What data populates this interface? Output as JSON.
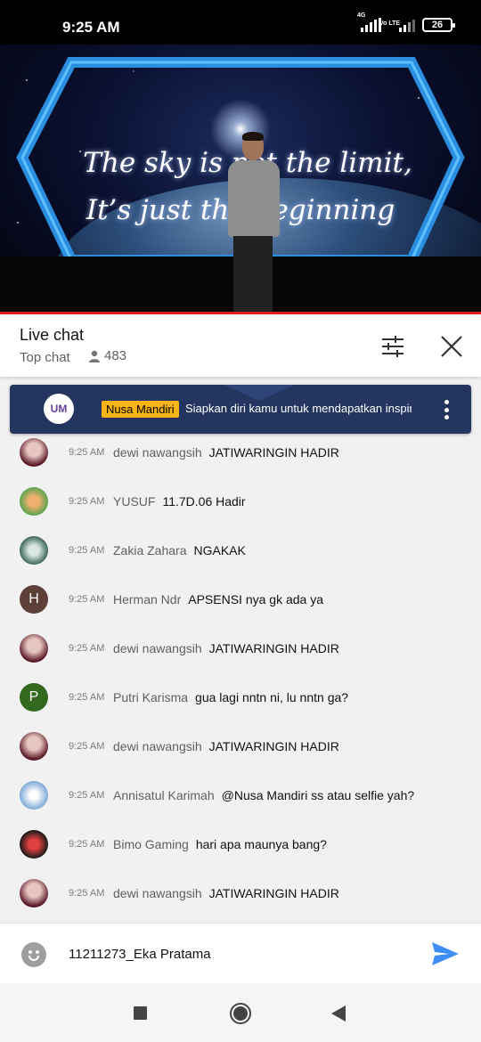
{
  "status_bar": {
    "time": "9:25 AM",
    "net_1": "4G",
    "net_2": "Vo LTE",
    "battery": "26"
  },
  "video": {
    "line1": "The sky is not the limit,",
    "line2": "It’s just the beginning"
  },
  "chat_header": {
    "title": "Live chat",
    "mode": "Top chat",
    "viewers": "483"
  },
  "pinned": {
    "author": "Nusa Mandiri",
    "text": "Siapkan diri kamu untuk mendapatkan inspirasi",
    "avatar_text": "UM"
  },
  "messages": [
    {
      "time": "9:25 AM",
      "author": "dewi nawangsih",
      "text": "JATIWARINGIN HADIR",
      "avatar": "photo"
    },
    {
      "time": "9:25 AM",
      "author": "YUSUF",
      "text": "11.7D.06 Hadir",
      "avatar": "photo"
    },
    {
      "time": "9:25 AM",
      "author": "Zakia Zahara",
      "text": "NGAKAK",
      "avatar": "photo"
    },
    {
      "time": "9:25 AM",
      "author": "Herman Ndr",
      "text": "APSENSI nya gk ada ya",
      "avatar": "H"
    },
    {
      "time": "9:25 AM",
      "author": "dewi nawangsih",
      "text": "JATIWARINGIN HADIR",
      "avatar": "photo"
    },
    {
      "time": "9:25 AM",
      "author": "Putri Karisma",
      "text": "gua lagi nntn ni, lu nntn ga?",
      "avatar": "P"
    },
    {
      "time": "9:25 AM",
      "author": "dewi nawangsih",
      "text": "JATIWARINGIN HADIR",
      "avatar": "photo"
    },
    {
      "time": "9:25 AM",
      "author": "Annisatul Karimah",
      "text": "@Nusa Mandiri ss atau selfie yah?",
      "avatar": "photo"
    },
    {
      "time": "9:25 AM",
      "author": "Bimo Gaming",
      "text": "hari apa maunya bang?",
      "avatar": "photo"
    },
    {
      "time": "9:25 AM",
      "author": "dewi nawangsih",
      "text": "JATIWARINGIN HADIR",
      "avatar": "photo"
    }
  ],
  "input": {
    "value": "11211273_Eka Pratama"
  },
  "colors": {
    "accent": "#3ea6ff",
    "progress": "#e21b1b",
    "pinned_bg": "#24365f",
    "badge": "#f7b416",
    "send": "#3e8ef7"
  }
}
